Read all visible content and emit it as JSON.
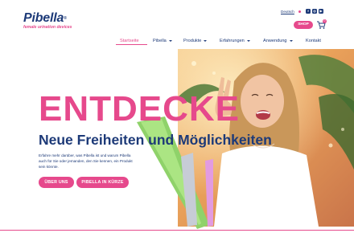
{
  "brand": {
    "name": "Pibella",
    "tagline": "female urination devices",
    "accent_color": "#e6498c",
    "primary_color": "#1d3a78"
  },
  "topbar": {
    "language": "Deutsch",
    "social_icons": [
      "facebook-icon",
      "instagram-icon",
      "youtube-icon"
    ],
    "shop_label": "SHOP",
    "cart_count": "0"
  },
  "nav": {
    "items": [
      {
        "label": "Startseite",
        "active": true,
        "dropdown": false
      },
      {
        "label": "Pibella",
        "active": false,
        "dropdown": true
      },
      {
        "label": "Produkte",
        "active": false,
        "dropdown": true
      },
      {
        "label": "Erfahrungen",
        "active": false,
        "dropdown": true
      },
      {
        "label": "Anwendung",
        "active": false,
        "dropdown": true
      },
      {
        "label": "Kontakt",
        "active": false,
        "dropdown": false
      }
    ]
  },
  "hero": {
    "headline": "ENTDECKE",
    "subheadline": "Neue Freiheiten und Möglichkeiten",
    "intro": "Erfahre mehr darüber, was Pibella ist und warum Pibella auch für Sie oder jemanden, den Sie kennen, ein Produkt sein könnte.",
    "buttons": [
      {
        "label": "ÜBER UNS"
      },
      {
        "label": "PIBELLA IN KÜRZE"
      }
    ]
  }
}
